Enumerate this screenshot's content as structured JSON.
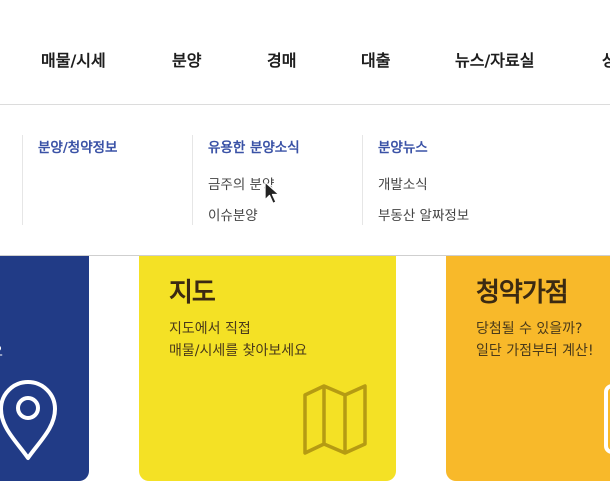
{
  "nav": {
    "items": [
      "매물/시세",
      "분양",
      "경매",
      "대출",
      "뉴스/자료실",
      "상"
    ]
  },
  "dropdown": {
    "columns": [
      {
        "title": "분양/청약정보",
        "links": []
      },
      {
        "title": "유용한 분양소식",
        "links": [
          "금주의 분양",
          "이슈분양"
        ]
      },
      {
        "title": "분양뉴스",
        "links": [
          "개발소식",
          "부동산 알짜정보"
        ]
      }
    ]
  },
  "cards": {
    "blue": {
      "desc_fragment": "요"
    },
    "yellow": {
      "title": "지도",
      "desc": [
        "지도에서 직접",
        "매물/시세를 찾아보세요"
      ]
    },
    "orange": {
      "title": "청약가점",
      "desc": [
        "당첨될 수 있을까?",
        "일단 가점부터 계산!"
      ]
    }
  },
  "colors": {
    "menu_title": "#3a52a6",
    "card_blue": "#213b86",
    "card_yellow": "#f4e125",
    "card_orange": "#f8b92a"
  },
  "icons": {
    "blue_card": "location-pin-icon",
    "yellow_card": "folded-map-icon",
    "orange_card": "calculator-icon",
    "pointer": "mouse-cursor-icon"
  }
}
